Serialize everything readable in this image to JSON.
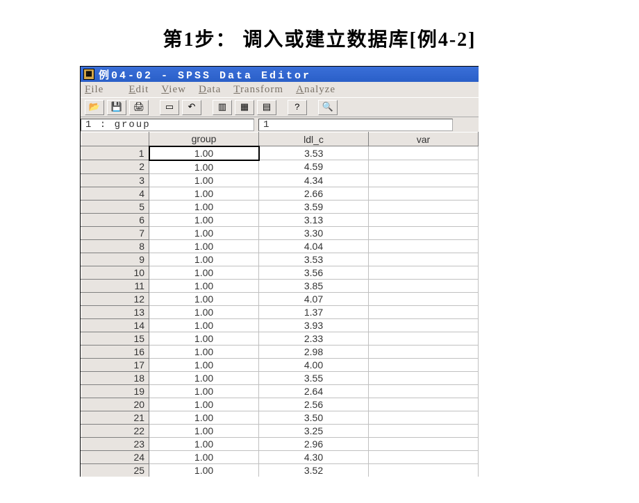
{
  "slide": {
    "title": "第1步：  调入或建立数据库[例4-2]"
  },
  "window": {
    "title": "例04-02 - SPSS Data Editor"
  },
  "menu": {
    "file": "File",
    "edit": "Edit",
    "view": "View",
    "data": "Data",
    "transform": "Transform",
    "analyze": "Analyze"
  },
  "toolbar_icons": [
    "📂",
    "💾",
    "🖨",
    "↶",
    "📋",
    "🧮",
    "📊",
    "📈",
    "📉",
    "❓",
    "🔍"
  ],
  "cell_indicator": {
    "address": "1 : group",
    "value": "1"
  },
  "columns": [
    "group",
    "ldl_c",
    "var"
  ],
  "rows": [
    {
      "n": "1",
      "group": "1.00",
      "ldl_c": "3.53"
    },
    {
      "n": "2",
      "group": "1.00",
      "ldl_c": "4.59"
    },
    {
      "n": "3",
      "group": "1.00",
      "ldl_c": "4.34"
    },
    {
      "n": "4",
      "group": "1.00",
      "ldl_c": "2.66"
    },
    {
      "n": "5",
      "group": "1.00",
      "ldl_c": "3.59"
    },
    {
      "n": "6",
      "group": "1.00",
      "ldl_c": "3.13"
    },
    {
      "n": "7",
      "group": "1.00",
      "ldl_c": "3.30"
    },
    {
      "n": "8",
      "group": "1.00",
      "ldl_c": "4.04"
    },
    {
      "n": "9",
      "group": "1.00",
      "ldl_c": "3.53"
    },
    {
      "n": "10",
      "group": "1.00",
      "ldl_c": "3.56"
    },
    {
      "n": "11",
      "group": "1.00",
      "ldl_c": "3.85"
    },
    {
      "n": "12",
      "group": "1.00",
      "ldl_c": "4.07"
    },
    {
      "n": "13",
      "group": "1.00",
      "ldl_c": "1.37"
    },
    {
      "n": "14",
      "group": "1.00",
      "ldl_c": "3.93"
    },
    {
      "n": "15",
      "group": "1.00",
      "ldl_c": "2.33"
    },
    {
      "n": "16",
      "group": "1.00",
      "ldl_c": "2.98"
    },
    {
      "n": "17",
      "group": "1.00",
      "ldl_c": "4.00"
    },
    {
      "n": "18",
      "group": "1.00",
      "ldl_c": "3.55"
    },
    {
      "n": "19",
      "group": "1.00",
      "ldl_c": "2.64"
    },
    {
      "n": "20",
      "group": "1.00",
      "ldl_c": "2.56"
    },
    {
      "n": "21",
      "group": "1.00",
      "ldl_c": "3.50"
    },
    {
      "n": "22",
      "group": "1.00",
      "ldl_c": "3.25"
    },
    {
      "n": "23",
      "group": "1.00",
      "ldl_c": "2.96"
    },
    {
      "n": "24",
      "group": "1.00",
      "ldl_c": "4.30"
    },
    {
      "n": "25",
      "group": "1.00",
      "ldl_c": "3.52"
    }
  ]
}
